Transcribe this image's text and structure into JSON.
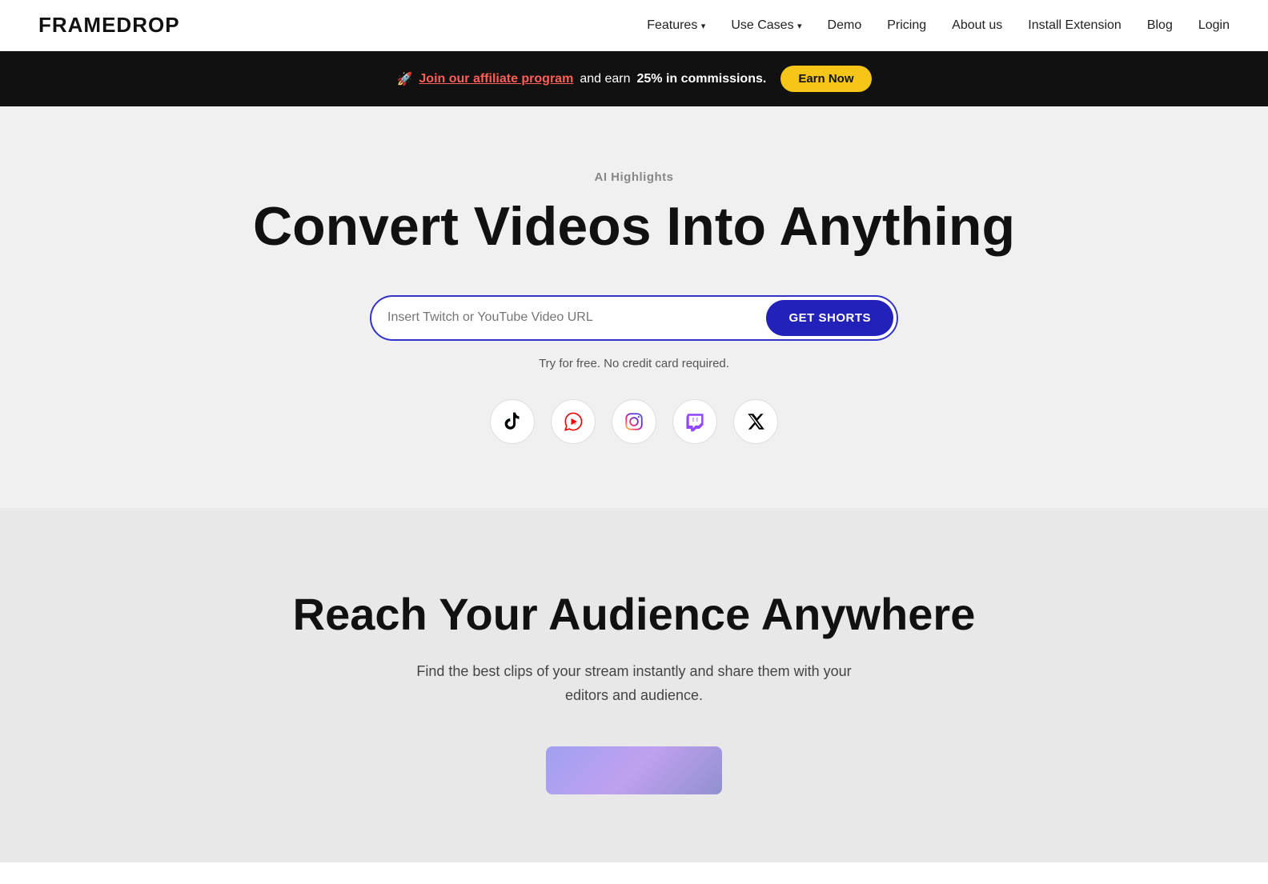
{
  "nav": {
    "logo": "FRAMEDROP",
    "links": [
      {
        "label": "Features",
        "hasDropdown": true
      },
      {
        "label": "Use Cases",
        "hasDropdown": true
      },
      {
        "label": "Demo",
        "hasDropdown": false
      },
      {
        "label": "Pricing",
        "hasDropdown": false
      },
      {
        "label": "About us",
        "hasDropdown": false
      },
      {
        "label": "Install Extension",
        "hasDropdown": false
      },
      {
        "label": "Blog",
        "hasDropdown": false
      },
      {
        "label": "Login",
        "hasDropdown": false
      }
    ]
  },
  "banner": {
    "emoji": "🚀",
    "pre_link": "",
    "affiliate_text": "Join our affiliate program",
    "post_text": " and earn ",
    "bold_text": "25% in commissions.",
    "cta_label": "Earn Now"
  },
  "hero": {
    "tag": "AI Highlights",
    "title": "Convert Videos Into Anything",
    "input_placeholder": "Insert Twitch or YouTube Video URL",
    "cta_label": "GET SHORTS",
    "free_note": "Try for free. No credit card required.",
    "social_icons": [
      {
        "name": "tiktok",
        "glyph": "♪"
      },
      {
        "name": "youtube-shorts",
        "glyph": "▶"
      },
      {
        "name": "instagram",
        "glyph": "◎"
      },
      {
        "name": "twitch",
        "glyph": "⬛"
      },
      {
        "name": "x-twitter",
        "glyph": "✕"
      }
    ]
  },
  "section2": {
    "title": "Reach Your Audience Anywhere",
    "description": "Find the best clips of your stream instantly and share them with your editors and audience."
  }
}
